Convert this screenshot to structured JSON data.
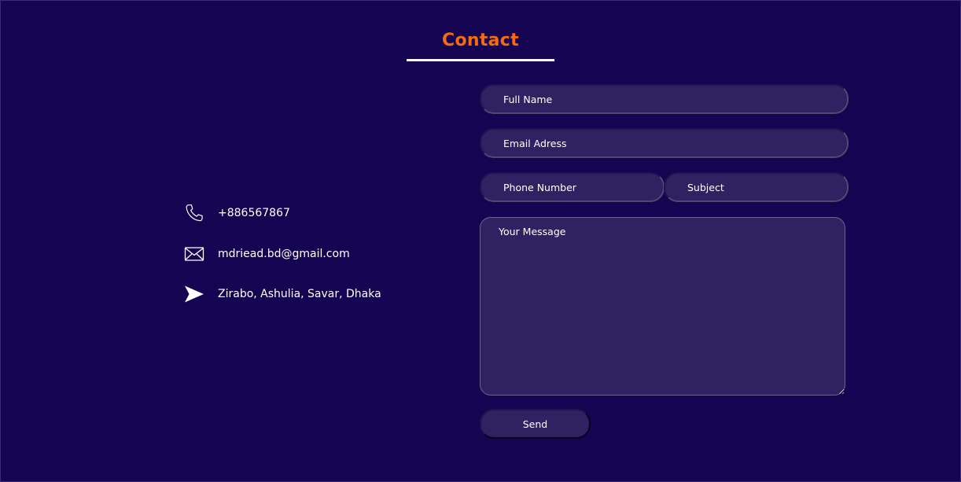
{
  "header": {
    "title": "Contact"
  },
  "contact_info": {
    "phone": {
      "icon": "phone-icon",
      "text": "+886567867"
    },
    "email": {
      "icon": "envelope-icon",
      "text": "mdriead.bd@gmail.com"
    },
    "address": {
      "icon": "send-arrow-icon",
      "text": "Zirabo, Ashulia, Savar, Dhaka"
    }
  },
  "form": {
    "full_name": {
      "placeholder": "Full Name",
      "value": ""
    },
    "email": {
      "placeholder": "Email Adress",
      "value": ""
    },
    "phone": {
      "placeholder": "Phone Number",
      "value": ""
    },
    "subject": {
      "placeholder": "Subject",
      "value": ""
    },
    "message": {
      "placeholder": "Your Message",
      "value": ""
    },
    "send_label": "Send"
  },
  "colors": {
    "background": "#150452",
    "accent": "#f56a12",
    "field_background": "#302262",
    "text": "#ffffff"
  }
}
